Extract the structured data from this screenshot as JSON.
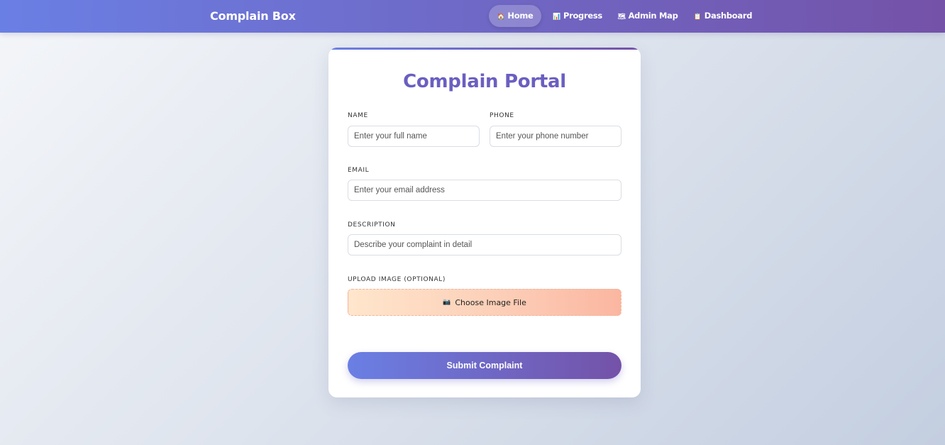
{
  "nav": {
    "brand": "Complain Box",
    "items": [
      {
        "icon": "🏠",
        "icon_name": "home-icon",
        "label": "Home",
        "active": true
      },
      {
        "icon": "📊",
        "icon_name": "chart-icon",
        "label": "Progress",
        "active": false
      },
      {
        "icon": "🗺",
        "icon_name": "map-icon",
        "label": "Admin Map",
        "active": false
      },
      {
        "icon": "📋",
        "icon_name": "clipboard-icon",
        "label": "Dashboard",
        "active": false
      }
    ]
  },
  "form": {
    "title": "Complain Portal",
    "name": {
      "label": "NAME",
      "placeholder": "Enter your full name",
      "value": ""
    },
    "phone": {
      "label": "PHONE",
      "placeholder": "Enter your phone number",
      "value": ""
    },
    "email": {
      "label": "EMAIL",
      "placeholder": "Enter your email address",
      "value": ""
    },
    "description": {
      "label": "DESCRIPTION",
      "placeholder": "Describe your complaint in detail",
      "value": ""
    },
    "upload": {
      "label": "UPLOAD IMAGE (OPTIONAL)",
      "icon": "📷",
      "icon_name": "camera-icon",
      "button_label": "Choose Image File"
    },
    "submit_label": "Submit Complaint"
  },
  "colors": {
    "accent_start": "#6a7fe4",
    "accent_end": "#7452a8",
    "title": "#6a5fc1"
  }
}
